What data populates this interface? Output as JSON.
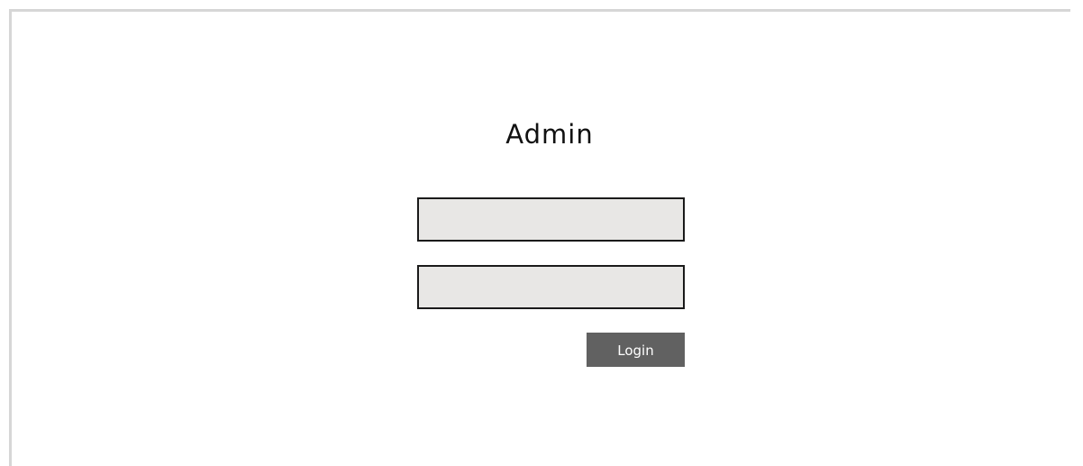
{
  "page": {
    "title": "Admin"
  },
  "form": {
    "username": {
      "value": "",
      "placeholder": ""
    },
    "password": {
      "value": "",
      "placeholder": ""
    },
    "login_label": "Login"
  },
  "colors": {
    "field_bg": "#e8e7e5",
    "button_bg": "#616161",
    "frame_line": "#d6d6d6"
  }
}
